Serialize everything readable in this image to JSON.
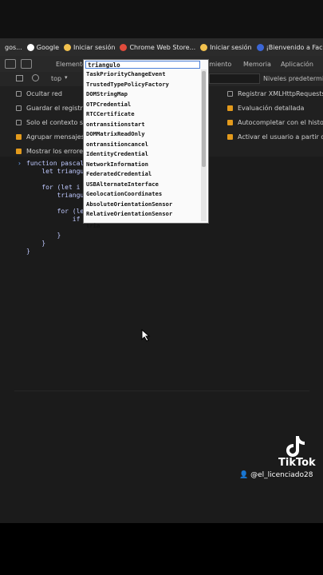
{
  "bookmarks": [
    {
      "label": "gos...",
      "icon": "folder-icon",
      "color": "#888888"
    },
    {
      "label": "Google",
      "icon": "google-icon",
      "color": "#ffffff"
    },
    {
      "label": "Iniciar sesión",
      "icon": "windows-icon",
      "color": "#f2c14e"
    },
    {
      "label": "Chrome Web Store...",
      "icon": "store-icon",
      "color": "#e04b3c"
    },
    {
      "label": "Iniciar sesión",
      "icon": "windows-icon",
      "color": "#f2c14e"
    },
    {
      "label": "¡Bienvenido a Faceb...",
      "icon": "facebook-icon",
      "color": "#3b66d6"
    }
  ],
  "devtools": {
    "tab_elements": "Elemento",
    "tab_rendimiento": "imiento",
    "tab_memoria": "Memoria",
    "tab_aplicacion": "Aplicación",
    "context": "top",
    "niveles": "Niveles predetermin"
  },
  "settings_left": [
    {
      "label": "Ocultar red",
      "checked": false
    },
    {
      "label": "Guardar el registro",
      "checked": false
    },
    {
      "label": "Solo el contexto sel",
      "checked": false
    },
    {
      "label": "Agrupar mensajes s",
      "checked": true
    },
    {
      "label": "Mostrar los errores",
      "checked": true
    }
  ],
  "settings_right": [
    {
      "label": "Registrar XMLHttpRequests",
      "checked": false
    },
    {
      "label": "Evaluación detallada",
      "checked": true
    },
    {
      "label": "Autocompletar con el historia",
      "checked": true
    },
    {
      "label": "Activar el usuario a partir de l",
      "checked": true
    }
  ],
  "code_lines": [
    "function pascal(",
    "    let triangul",
    "",
    "    for (let i =",
    "        triangul",
    "",
    "        for (let",
    "            if (",
    "",
    "        }",
    "    }",
    "}"
  ],
  "autocomplete": {
    "input": "triangulo",
    "items": [
      "TaskPriorityChangeEvent",
      "TrustedTypePolicyFactory",
      "DOMStringMap",
      "OTPCredential",
      "RTCCertificate",
      "ontransitionstart",
      "DOMMatrixReadOnly",
      "ontransitioncancel",
      "IdentityCredential",
      "NetworkInformation",
      "FederatedCredential",
      "USBAlternateInterface",
      "GeolocationCoordinates",
      "AbsoluteOrientationSensor",
      "RelativeOrientationSensor"
    ],
    "typed": "tria"
  },
  "watermark": {
    "brand": "TikTok",
    "user": "@el_licenciado28"
  }
}
